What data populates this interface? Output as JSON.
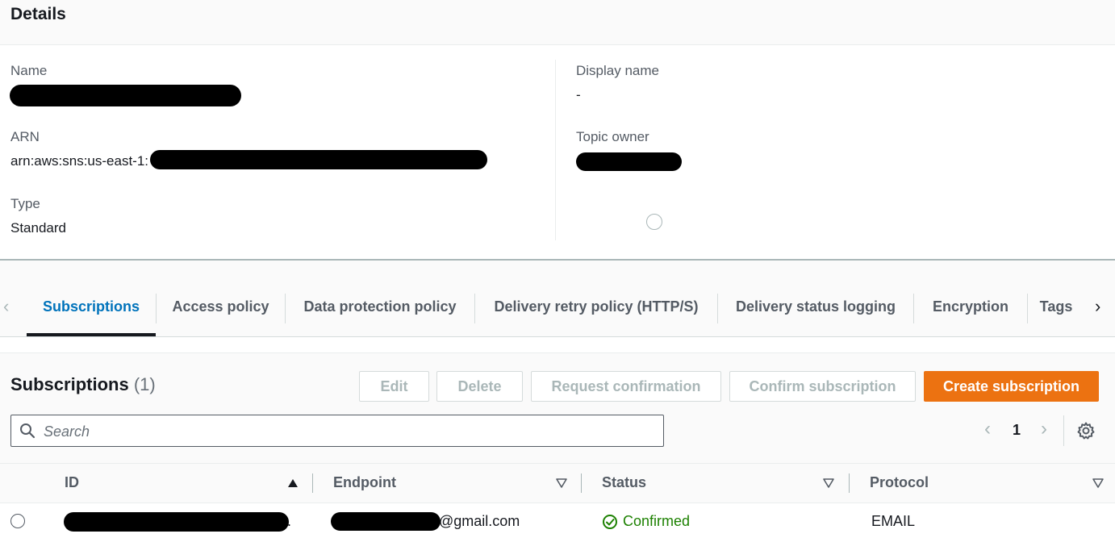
{
  "details": {
    "title": "Details",
    "name_label": "Name",
    "arn_label": "ARN",
    "arn_value": "arn:aws:sns:us-east-1:",
    "type_label": "Type",
    "type_value": "Standard",
    "display_name_label": "Display name",
    "display_name_value": "-",
    "topic_owner_label": "Topic owner"
  },
  "tabs": [
    {
      "label": "Subscriptions",
      "active": true
    },
    {
      "label": "Access policy",
      "active": false
    },
    {
      "label": "Data protection policy",
      "active": false
    },
    {
      "label": "Delivery retry policy (HTTP/S)",
      "active": false
    },
    {
      "label": "Delivery status logging",
      "active": false
    },
    {
      "label": "Encryption",
      "active": false
    },
    {
      "label": "Tags",
      "active": false
    }
  ],
  "subscriptions": {
    "title": "Subscriptions",
    "count": "(1)",
    "buttons": {
      "edit": "Edit",
      "delete": "Delete",
      "request_confirmation": "Request confirmation",
      "confirm_subscription": "Confirm subscription",
      "create_subscription": "Create subscription"
    },
    "search_placeholder": "Search",
    "page": "1",
    "columns": {
      "id": "ID",
      "endpoint": "Endpoint",
      "status": "Status",
      "protocol": "Protocol"
    },
    "rows": [
      {
        "id_suffix": ".",
        "endpoint_suffix": "@gmail.com",
        "status": "Confirmed",
        "protocol": "EMAIL"
      }
    ]
  },
  "colors": {
    "accent": "#0073bb",
    "primary_button": "#ec7211",
    "status_confirmed": "#1d8102"
  }
}
